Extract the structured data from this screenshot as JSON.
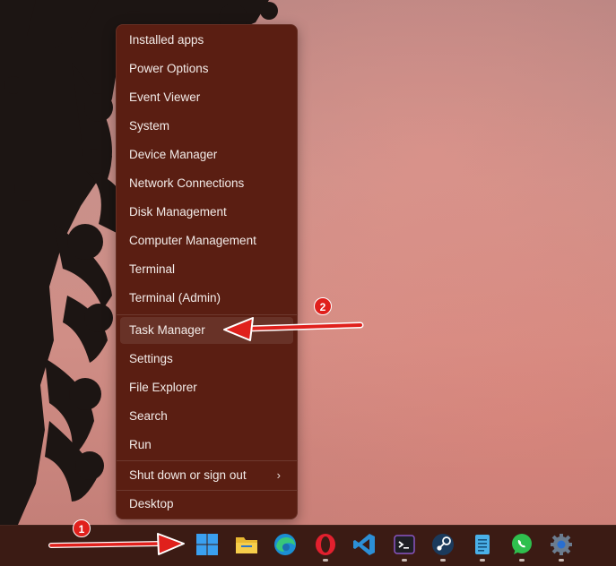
{
  "context_menu": {
    "items": [
      {
        "label": "Installed apps"
      },
      {
        "label": "Power Options"
      },
      {
        "label": "Event Viewer"
      },
      {
        "label": "System"
      },
      {
        "label": "Device Manager"
      },
      {
        "label": "Network Connections"
      },
      {
        "label": "Disk Management"
      },
      {
        "label": "Computer Management"
      },
      {
        "label": "Terminal"
      },
      {
        "label": "Terminal (Admin)"
      },
      {
        "label": "Task Manager"
      },
      {
        "label": "Settings"
      },
      {
        "label": "File Explorer"
      },
      {
        "label": "Search"
      },
      {
        "label": "Run"
      },
      {
        "label": "Shut down or sign out"
      },
      {
        "label": "Desktop"
      }
    ],
    "highlighted_item": "Task Manager",
    "submenu_chevron": "›"
  },
  "taskbar": {
    "apps": [
      {
        "name": "start-button",
        "icon": "windows-logo-icon",
        "running": false
      },
      {
        "name": "file-explorer",
        "icon": "folder-icon",
        "running": false
      },
      {
        "name": "microsoft-edge",
        "icon": "edge-icon",
        "running": false
      },
      {
        "name": "opera",
        "icon": "opera-icon",
        "running": true
      },
      {
        "name": "visual-studio-code",
        "icon": "vscode-icon",
        "running": false
      },
      {
        "name": "terminal",
        "icon": "terminal-icon",
        "running": true
      },
      {
        "name": "steam",
        "icon": "steam-icon",
        "running": true
      },
      {
        "name": "notepad",
        "icon": "notepad-icon",
        "running": true
      },
      {
        "name": "whatsapp",
        "icon": "whatsapp-icon",
        "running": true
      },
      {
        "name": "settings",
        "icon": "gear-icon",
        "running": true
      }
    ]
  },
  "annotations": {
    "step1": "1",
    "step2": "2"
  },
  "colors": {
    "menu_background": "#5a1e12",
    "taskbar_background": "#3b1b14",
    "annotation_red": "#e0201c"
  }
}
